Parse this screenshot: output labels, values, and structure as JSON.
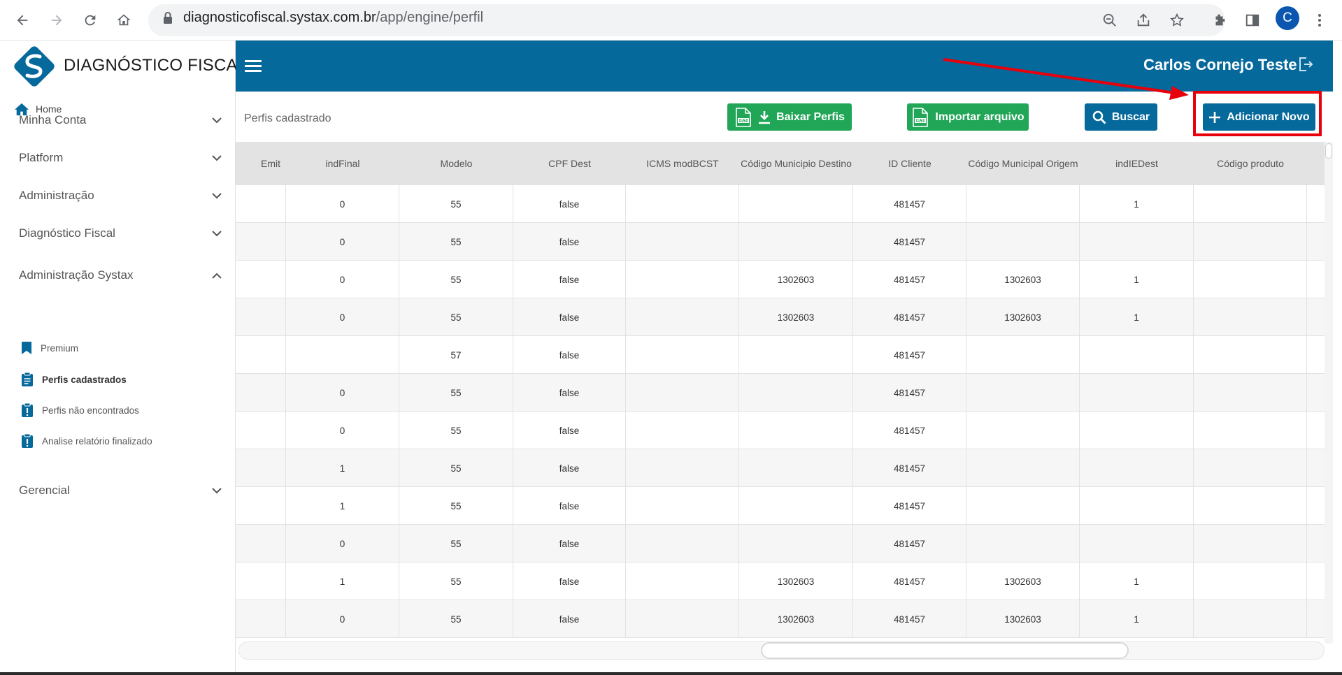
{
  "browser": {
    "url_host": "diagnosticofiscal.systax.com.br",
    "url_path": "/app/engine/perfil",
    "profile_initial": "C"
  },
  "brand": {
    "name": "DIAGNÓSTICO FISCAL"
  },
  "sidebar": {
    "home_label": "Home",
    "menu": [
      {
        "label": "Minha Conta",
        "state": "collapsed"
      },
      {
        "label": "Platform",
        "state": "collapsed"
      },
      {
        "label": "Administração",
        "state": "collapsed"
      },
      {
        "label": "Diagnóstico Fiscal",
        "state": "collapsed"
      },
      {
        "label": "Administração Systax",
        "state": "expanded"
      },
      {
        "label": "Gerencial",
        "state": "collapsed"
      }
    ],
    "submenu": [
      {
        "label": "Premium",
        "icon": "bookmark-icon"
      },
      {
        "label": "Perfis cadastrados",
        "icon": "clipboard-list-icon",
        "active": true
      },
      {
        "label": "Perfis não encontrados",
        "icon": "clipboard-alert-icon"
      },
      {
        "label": "Analise relatório finalizado",
        "icon": "clipboard-alert-icon"
      }
    ]
  },
  "header": {
    "username": "Carlos Cornejo Teste"
  },
  "toolbar": {
    "page_label": "Perfis cadastrado",
    "download_label": "Baixar Perfis",
    "import_label": "Importar arquivo",
    "search_label": "Buscar",
    "add_label": "Adicionar Novo"
  },
  "colors": {
    "primary": "#05699c",
    "success": "#21a657",
    "highlight": "#e8000b"
  },
  "table": {
    "columns": [
      "Emit",
      "indFinal",
      "Modelo",
      "CPF Dest",
      "ICMS modBCST",
      "Código Municipio Destino",
      "ID Cliente",
      "Código Municipal Origem",
      "indIEDest",
      "Código produto"
    ],
    "rows": [
      [
        "",
        "0",
        "55",
        "false",
        "",
        "",
        "481457",
        "",
        "1",
        ""
      ],
      [
        "",
        "0",
        "55",
        "false",
        "",
        "",
        "481457",
        "",
        "",
        ""
      ],
      [
        "",
        "0",
        "55",
        "false",
        "",
        "1302603",
        "481457",
        "1302603",
        "1",
        ""
      ],
      [
        "",
        "0",
        "55",
        "false",
        "",
        "1302603",
        "481457",
        "1302603",
        "1",
        ""
      ],
      [
        "",
        "",
        "57",
        "false",
        "",
        "",
        "481457",
        "",
        "",
        ""
      ],
      [
        "",
        "0",
        "55",
        "false",
        "",
        "",
        "481457",
        "",
        "",
        ""
      ],
      [
        "",
        "0",
        "55",
        "false",
        "",
        "",
        "481457",
        "",
        "",
        ""
      ],
      [
        "",
        "1",
        "55",
        "false",
        "",
        "",
        "481457",
        "",
        "",
        ""
      ],
      [
        "",
        "1",
        "55",
        "false",
        "",
        "",
        "481457",
        "",
        "",
        ""
      ],
      [
        "",
        "0",
        "55",
        "false",
        "",
        "",
        "481457",
        "",
        "",
        ""
      ],
      [
        "",
        "1",
        "55",
        "false",
        "",
        "1302603",
        "481457",
        "1302603",
        "1",
        ""
      ],
      [
        "",
        "0",
        "55",
        "false",
        "",
        "1302603",
        "481457",
        "1302603",
        "1",
        ""
      ]
    ]
  }
}
